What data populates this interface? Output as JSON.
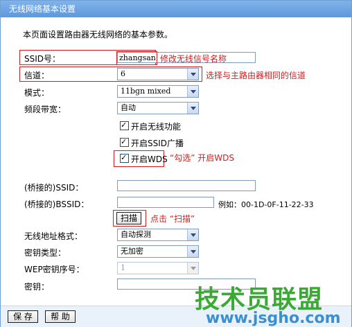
{
  "title": "无线网络基本设置",
  "intro": "本页面设置路由器无线网络的基本参数。",
  "fields": {
    "ssid": {
      "label": "SSID号：",
      "value": "zhangsan"
    },
    "channel": {
      "label": "信道：",
      "value": "6"
    },
    "mode": {
      "label": "模式：",
      "value": "11bgn mixed"
    },
    "bandwidth": {
      "label": "频段带宽：",
      "value": "自动"
    },
    "enable_wireless": {
      "label": "开启无线功能",
      "checked": true
    },
    "enable_ssid_broadcast": {
      "label": "开启SSID广播",
      "checked": true
    },
    "enable_wds": {
      "label": "开启WDS",
      "checked": true
    },
    "bridged_ssid": {
      "label": "(桥接的)SSID：",
      "value": ""
    },
    "bridged_bssid": {
      "label": "(桥接的)BSSID：",
      "value": "",
      "example": "例如：00-1D-0F-11-22-33"
    },
    "scan_button": "扫描",
    "address_format": {
      "label": "无线地址格式：",
      "value": "自动探测"
    },
    "key_type": {
      "label": "密钥类型：",
      "value": "无加密"
    },
    "wep_index": {
      "label": "WEP密钥序号：",
      "value": "1"
    },
    "key": {
      "label": "密钥：",
      "value": ""
    }
  },
  "annotations": {
    "ssid_note": "修改无线信号名称",
    "channel_note": "选择与主路由器相同的信道",
    "wds_note": "“勾选” 开启WDS",
    "scan_note": "点击 “扫描”"
  },
  "footer": {
    "save": "保 存",
    "help": "帮 助"
  },
  "watermark": {
    "logo_text": "技术员联盟",
    "url": "www.jsgho.com"
  },
  "colors": {
    "titlebar": "#6fa6e2",
    "annotation": "#d41b1b",
    "footer_bg": "#e9f1fb"
  }
}
